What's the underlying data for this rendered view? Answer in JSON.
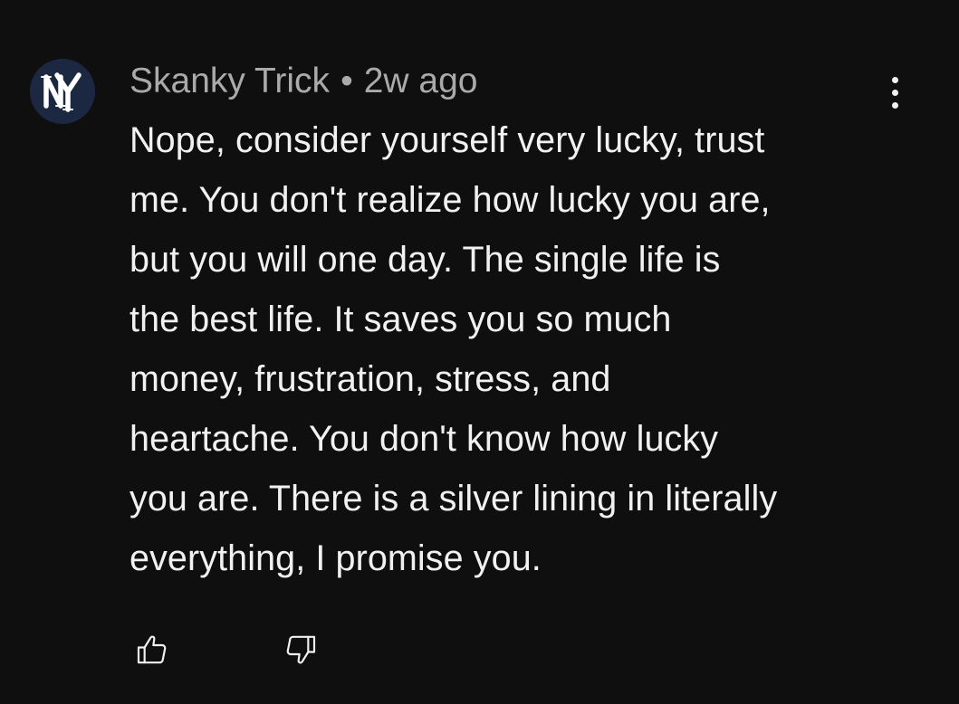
{
  "comment": {
    "avatar_icon": "ny-logo-avatar",
    "author": "Skanky Trick",
    "separator": "•",
    "time": "2w ago",
    "lines": [
      "Nope, consider yourself very lucky, trust",
      "me. You don't realize how lucky you are,",
      "but you will one day. The single life is",
      "the best life. It saves you so much",
      "money, frustration, stress, and",
      "heartache. You don't know how lucky",
      "you are. There is a silver lining in literally",
      "everything, I promise you."
    ]
  },
  "actions": {
    "like_icon": "thumbs-up-icon",
    "dislike_icon": "thumbs-down-icon",
    "more_icon": "more-vertical-icon"
  },
  "colors": {
    "background": "#0f0f0f",
    "text_primary": "#f1f1f1",
    "text_secondary": "#aaaaaa",
    "avatar_bg": "#1c2841"
  }
}
